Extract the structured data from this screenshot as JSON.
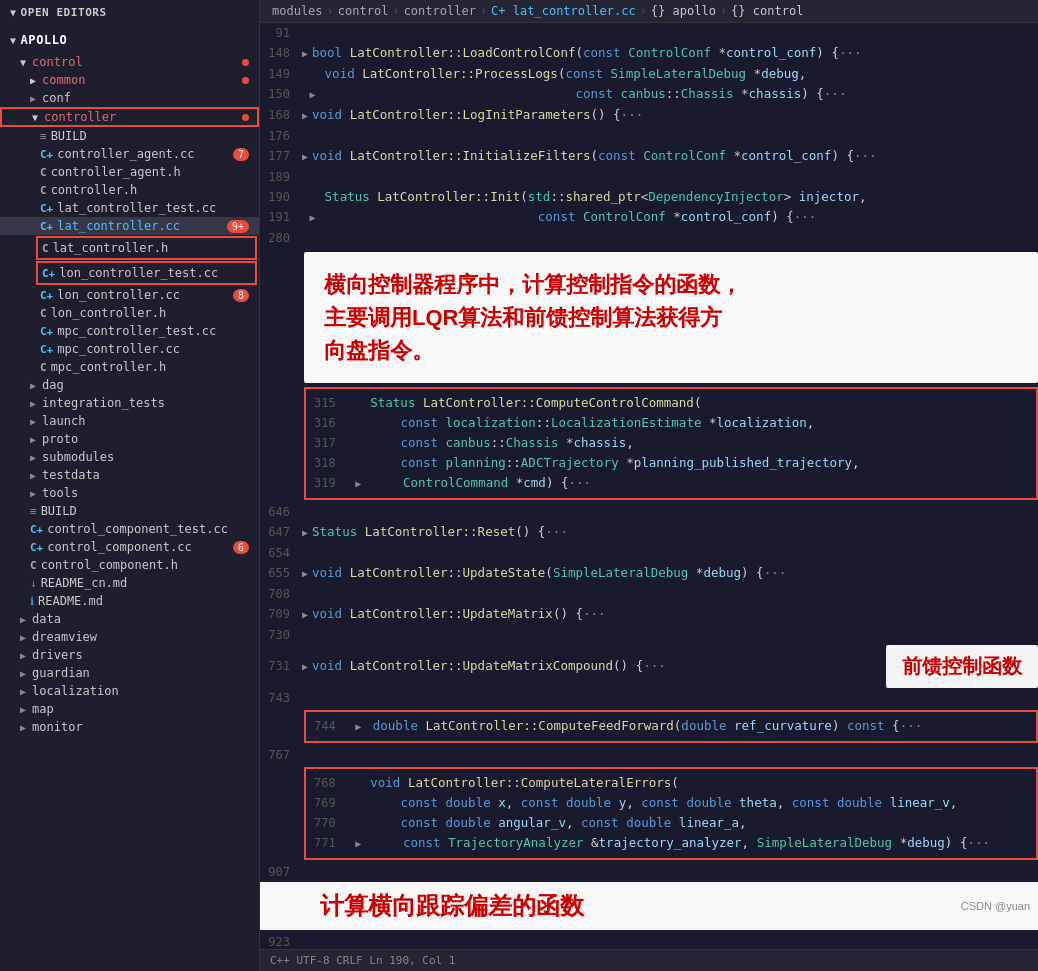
{
  "breadcrumb": {
    "items": [
      "modules",
      "control",
      "controller",
      "lat_controller.cc",
      "{} apollo",
      "{} control"
    ]
  },
  "sidebar": {
    "open_editors_label": "OPEN EDITORS",
    "apollo_label": "APOLLO",
    "items": [
      {
        "label": "control",
        "type": "group",
        "level": 1,
        "open": true,
        "dot": true
      },
      {
        "label": "common",
        "type": "group",
        "level": 2,
        "dot": true
      },
      {
        "label": "conf",
        "type": "group",
        "level": 2
      },
      {
        "label": "controller",
        "type": "group",
        "level": 2,
        "open": true,
        "highlighted": true,
        "dot": true
      },
      {
        "label": "BUILD",
        "type": "build",
        "level": 3
      },
      {
        "label": "controller_agent.cc",
        "type": "cc",
        "level": 3,
        "badge": "7"
      },
      {
        "label": "controller_agent.h",
        "type": "h",
        "level": 3
      },
      {
        "label": "controller.h",
        "type": "h",
        "level": 3
      },
      {
        "label": "lat_controller_test.cc",
        "type": "cc",
        "level": 3
      },
      {
        "label": "lat_controller.cc",
        "type": "cc",
        "level": 3,
        "badge": "9+",
        "active": true
      },
      {
        "label": "lat_controller.h",
        "type": "h",
        "level": 3,
        "highlighted": true
      },
      {
        "label": "lon_controller_test.cc",
        "type": "cc",
        "level": 3,
        "highlighted": true
      },
      {
        "label": "lon_controller.cc",
        "type": "cc",
        "level": 3,
        "badge": "8"
      },
      {
        "label": "lon_controller.h",
        "type": "h",
        "level": 3
      },
      {
        "label": "mpc_controller_test.cc",
        "type": "cc",
        "level": 3
      },
      {
        "label": "mpc_controller.cc",
        "type": "cc",
        "level": 3
      },
      {
        "label": "mpc_controller.h",
        "type": "h",
        "level": 3
      },
      {
        "label": "dag",
        "type": "group",
        "level": 2
      },
      {
        "label": "integration_tests",
        "type": "group",
        "level": 2
      },
      {
        "label": "launch",
        "type": "group",
        "level": 2
      },
      {
        "label": "proto",
        "type": "group",
        "level": 2
      },
      {
        "label": "submodules",
        "type": "group",
        "level": 2
      },
      {
        "label": "testdata",
        "type": "group",
        "level": 2
      },
      {
        "label": "tools",
        "type": "group",
        "level": 2
      },
      {
        "label": "BUILD",
        "type": "build",
        "level": 2
      },
      {
        "label": "control_component_test.cc",
        "type": "cc",
        "level": 2
      },
      {
        "label": "control_component.cc",
        "type": "cc",
        "level": 2,
        "badge": "6"
      },
      {
        "label": "control_component.h",
        "type": "h",
        "level": 2
      },
      {
        "label": "README_cn.md",
        "type": "readme",
        "level": 2
      },
      {
        "label": "README.md",
        "type": "readme-i",
        "level": 2
      },
      {
        "label": "data",
        "type": "group",
        "level": 1
      },
      {
        "label": "dreamview",
        "type": "group",
        "level": 1
      },
      {
        "label": "drivers",
        "type": "group",
        "level": 1
      },
      {
        "label": "guardian",
        "type": "group",
        "level": 1
      },
      {
        "label": "localization",
        "type": "group",
        "level": 1
      },
      {
        "label": "map",
        "type": "group",
        "level": 1
      },
      {
        "label": "monitor",
        "type": "group",
        "level": 1
      }
    ]
  },
  "code": {
    "annotation1": "横向控制器程序中，计算控制指令的函数，\n主要调用LQR算法和前馈控制算法获得方\n向盘指令。",
    "annotation2": "前馈控制函数",
    "annotation3": "计算横向跟踪偏差的函数",
    "lines": [
      {
        "num": "91",
        "content": ""
      },
      {
        "num": "148",
        "content": "> bool LatController::LoadControlConf(const ControlConf *control_conf) {···"
      },
      {
        "num": "149",
        "content": "   void LatController::ProcessLogs(const SimpleLateralDebug *debug,"
      },
      {
        "num": "150",
        "content": ">                                   const canbus::Chassis *chassis) {···"
      },
      {
        "num": "168",
        "content": "> void LatController::LogInitParameters() {···"
      },
      {
        "num": "176",
        "content": ""
      },
      {
        "num": "177",
        "content": "> void LatController::InitializeFilters(const ControlConf *control_conf) {···"
      },
      {
        "num": "189",
        "content": ""
      },
      {
        "num": "190",
        "content": "   Status LatController::Init(std::shared_ptr<DependencyInjector> injector,"
      },
      {
        "num": "191",
        "content": ">                              const ControlConf *control_conf) {···"
      },
      {
        "num": "280",
        "content": ""
      },
      {
        "num": "315",
        "content": "   Status LatController::ComputeControlCommand("
      },
      {
        "num": "316",
        "content": "       const localization::LocalizationEstimate *localization,"
      },
      {
        "num": "317",
        "content": "       const canbus::Chassis *chassis,"
      },
      {
        "num": "318",
        "content": "       const planning::ADCTrajectory *planning_published_trajectory,"
      },
      {
        "num": "319",
        "content": ">      ControlCommand *cmd) {···"
      },
      {
        "num": "646",
        "content": ""
      },
      {
        "num": "647",
        "content": "> Status LatController::Reset() {···"
      },
      {
        "num": "654",
        "content": ""
      },
      {
        "num": "655",
        "content": "> void LatController::UpdateState(SimpleLateralDebug *debug) {···"
      },
      {
        "num": "708",
        "content": ""
      },
      {
        "num": "709",
        "content": "> void LatController::UpdateMatrix() {···"
      },
      {
        "num": "730",
        "content": ""
      },
      {
        "num": "731",
        "content": "> void LatController::UpdateMatrixCompound() {···"
      },
      {
        "num": "743",
        "content": ""
      },
      {
        "num": "744",
        "content": "> double LatController::ComputeFeedForward(double ref_curvature) const {···"
      },
      {
        "num": "767",
        "content": ""
      },
      {
        "num": "768",
        "content": "   void LatController::ComputeLateralErrors("
      },
      {
        "num": "769",
        "content": "       const double x, const double y, const double theta, const double linear_v,"
      },
      {
        "num": "770",
        "content": "       const double angular_v, const double linear_a,"
      },
      {
        "num": "771",
        "content": ">      const TrajectoryAnalyzer &trajectory_analyzer, SimpleLateralDebug *debug) {···"
      },
      {
        "num": "907",
        "content": ""
      },
      {
        "num": "923",
        "content": ""
      }
    ]
  }
}
